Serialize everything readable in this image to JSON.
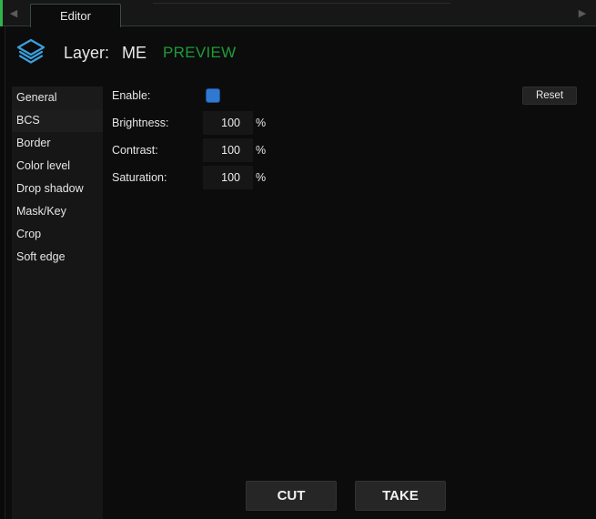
{
  "tabs": [
    {
      "label": "Editor"
    }
  ],
  "header": {
    "layer_label": "Layer:",
    "layer_name": "ME",
    "mode": "PREVIEW",
    "icon": "layers-icon",
    "mode_color": "#1e9b3a"
  },
  "sidebar": {
    "items": [
      {
        "label": "General"
      },
      {
        "label": "BCS"
      },
      {
        "label": "Border"
      },
      {
        "label": "Color level"
      },
      {
        "label": "Drop shadow"
      },
      {
        "label": "Mask/Key"
      },
      {
        "label": "Crop"
      },
      {
        "label": "Soft edge"
      }
    ],
    "active": "BCS"
  },
  "bcs": {
    "enable_label": "Enable:",
    "enable_checked": true,
    "reset_label": "Reset",
    "brightness_label": "Brightness:",
    "brightness_value": "100",
    "contrast_label": "Contrast:",
    "contrast_value": "100",
    "saturation_label": "Saturation:",
    "saturation_value": "100",
    "unit": "%"
  },
  "actions": {
    "cut_label": "CUT",
    "take_label": "TAKE"
  },
  "colors": {
    "accent": "#2f79d3",
    "preview_green": "#1e9b3a",
    "background": "#0c0c0c"
  }
}
